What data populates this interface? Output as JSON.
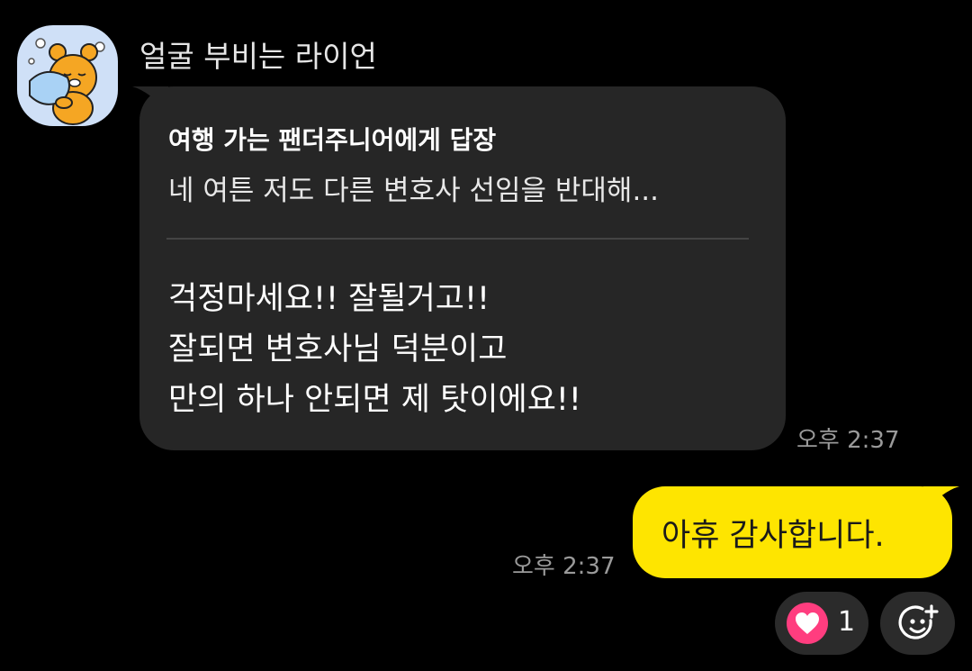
{
  "incoming": {
    "sender_name": "얼굴 부비는 라이언",
    "reply_title": "여행 가는 팬더주니어에게 답장",
    "reply_preview": "네 여튼 저도 다른 변호사 선임을 반대해...",
    "lines": [
      "걱정마세요!! 잘될거고!!",
      "잘되면 변호사님 덕분이고",
      "만의 하나 안되면 제 탓이에요!!"
    ],
    "time": "오후 2:37"
  },
  "outgoing": {
    "text": "아휴 감사합니다.",
    "time": "오후 2:37"
  },
  "reactions": {
    "heart_icon": "heart-icon",
    "heart_count": "1",
    "add_icon": "smiley-plus-icon"
  },
  "colors": {
    "background": "#000000",
    "incoming_bubble": "#262626",
    "outgoing_bubble": "#fee500",
    "heart": "#ff3d7f",
    "timestamp": "#9a9a9a"
  }
}
